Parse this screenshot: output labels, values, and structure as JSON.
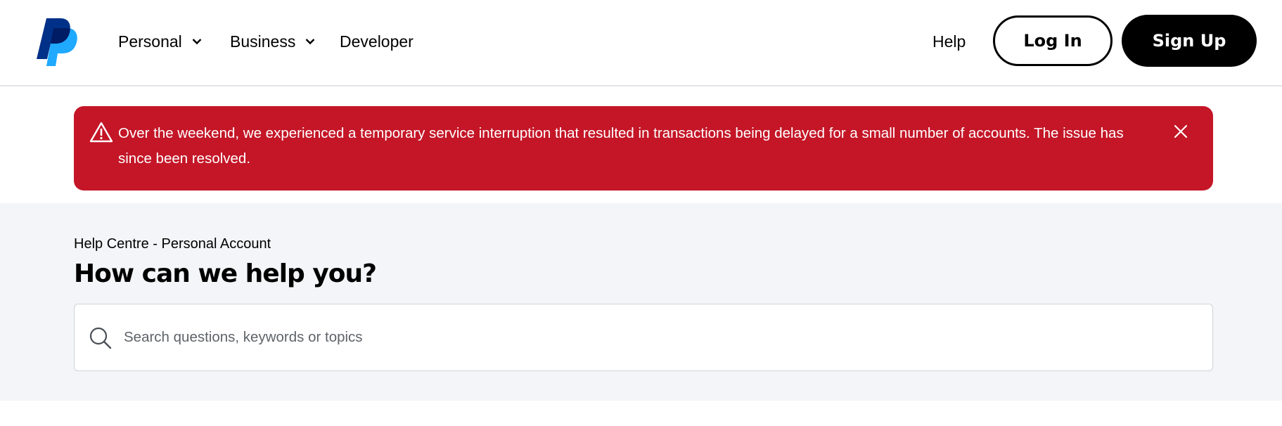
{
  "brand": {
    "logo_name": "paypal-logo",
    "colors": {
      "logo_dark": "#003087",
      "logo_light": "#1fa9ff",
      "alert_bg": "#c41627",
      "help_bg": "#f4f5f8"
    }
  },
  "nav": {
    "personal": "Personal",
    "business": "Business",
    "developer": "Developer",
    "help": "Help",
    "login": "Log In",
    "signup": "Sign Up"
  },
  "alert": {
    "icon": "warning-triangle-icon",
    "message": "Over the weekend, we experienced a temporary service interruption that resulted in transactions being delayed for a small number of accounts. The issue has since been resolved.",
    "close_icon": "close-icon"
  },
  "help": {
    "breadcrumb": "Help Centre - Personal Account",
    "title": "How can we help you?",
    "search_placeholder": "Search questions, keywords or topics",
    "search_value": ""
  }
}
